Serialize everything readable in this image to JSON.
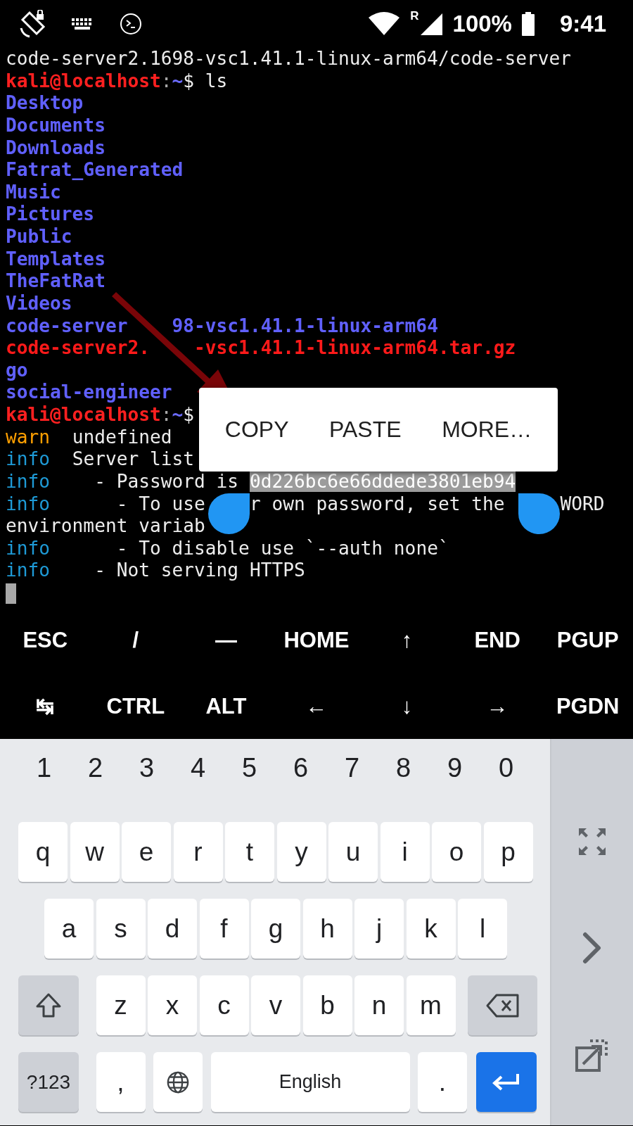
{
  "status_bar": {
    "roaming": "R",
    "battery": "100%",
    "time": "9:41"
  },
  "terminal": {
    "cursor": true,
    "lines": [
      [
        {
          "kind": "plain",
          "text": "code-server2.1698-vsc1.41.1-linux-arm64/code-server"
        }
      ],
      [
        {
          "kind": "user",
          "text": "kali@localhost"
        },
        {
          "kind": "sep",
          "text": ":"
        },
        {
          "kind": "home",
          "text": "~"
        },
        {
          "kind": "plain",
          "text": "$ ls"
        }
      ],
      [
        {
          "kind": "dir",
          "text": "Desktop"
        }
      ],
      [
        {
          "kind": "dir",
          "text": "Documents"
        }
      ],
      [
        {
          "kind": "dir",
          "text": "Downloads"
        }
      ],
      [
        {
          "kind": "dir",
          "text": "Fatrat_Generated"
        }
      ],
      [
        {
          "kind": "dir",
          "text": "Music"
        }
      ],
      [
        {
          "kind": "dir",
          "text": "Pictures"
        }
      ],
      [
        {
          "kind": "dir",
          "text": "Public"
        }
      ],
      [
        {
          "kind": "dir",
          "text": "Templates"
        }
      ],
      [
        {
          "kind": "dir",
          "text": "TheFatRat"
        }
      ],
      [
        {
          "kind": "dir",
          "text": "Videos"
        }
      ],
      [
        {
          "kind": "dir",
          "text": "code-server"
        },
        {
          "kind": "dir",
          "text": "    98-vsc1.41.1-linux-arm64"
        }
      ],
      [
        {
          "kind": "archive",
          "text": "code-server2."
        },
        {
          "kind": "archive",
          "text": "    -vsc1.41.1-linux-arm64.tar.gz"
        }
      ],
      [
        {
          "kind": "dir",
          "text": "go"
        }
      ],
      [
        {
          "kind": "dir",
          "text": "social-engineer"
        }
      ],
      [
        {
          "kind": "user",
          "text": "kali@localhost"
        },
        {
          "kind": "sep",
          "text": ":"
        },
        {
          "kind": "home",
          "text": "~"
        },
        {
          "kind": "plain",
          "text": "$"
        }
      ],
      [
        {
          "kind": "warn",
          "text": "warn"
        },
        {
          "kind": "plain",
          "text": "  undefined"
        }
      ],
      [
        {
          "kind": "info",
          "text": "info"
        },
        {
          "kind": "plain",
          "text": "  Server list"
        }
      ],
      [
        {
          "kind": "info",
          "text": "info"
        },
        {
          "kind": "plain",
          "text": "    - Password is "
        },
        {
          "kind": "selected",
          "text": "0d226bc6e66ddede3801eb94"
        }
      ],
      [
        {
          "kind": "info",
          "text": "info"
        },
        {
          "kind": "plain",
          "text": "      - To use"
        },
        {
          "kind": "plain",
          "text": "    r own password, set the"
        },
        {
          "kind": "plain",
          "text": "     WORD"
        }
      ],
      [
        {
          "kind": "plain",
          "text": "environment variab"
        }
      ],
      [
        {
          "kind": "info",
          "text": "info"
        },
        {
          "kind": "plain",
          "text": "      - To disable use `--auth none`"
        }
      ],
      [
        {
          "kind": "info",
          "text": "info"
        },
        {
          "kind": "plain",
          "text": "    - Not serving HTTPS"
        }
      ]
    ]
  },
  "context_menu": [
    "COPY",
    "PASTE",
    "MORE…"
  ],
  "extra_keys": [
    [
      "ESC",
      "/",
      "—",
      "HOME",
      "↑",
      "END",
      "PGUP"
    ],
    [
      "↹",
      "CTRL",
      "ALT",
      "←",
      "↓",
      "→",
      "PGDN"
    ]
  ],
  "keyboard": {
    "numbers": [
      "1",
      "2",
      "3",
      "4",
      "5",
      "6",
      "7",
      "8",
      "9",
      "0"
    ],
    "rows": [
      [
        "q",
        "w",
        "e",
        "r",
        "t",
        "y",
        "u",
        "i",
        "o",
        "p"
      ],
      [
        "a",
        "s",
        "d",
        "f",
        "g",
        "h",
        "j",
        "k",
        "l"
      ],
      [
        "z",
        "x",
        "c",
        "v",
        "b",
        "n",
        "m"
      ]
    ],
    "symbols_key": "?123",
    "comma": ",",
    "space": "English",
    "period": "."
  }
}
